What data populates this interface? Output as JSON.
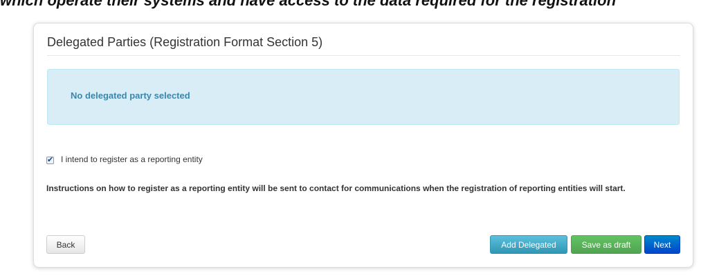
{
  "clipped_header": "which operate their systems and have access to the data required for the registration",
  "panel": {
    "title": "Delegated Parties (Registration Format Section 5)",
    "info_message": "No delegated party selected",
    "checkbox": {
      "checked": true,
      "label": "I intend to register as a reporting entity"
    },
    "instructions": "Instructions on how to register as a reporting entity will be sent to contact for communications when the registration of reporting entities will start."
  },
  "buttons": {
    "back": "Back",
    "add_delegated": "Add Delegated",
    "save_draft": "Save as draft",
    "next": "Next"
  },
  "colors": {
    "info_bg": "#d9edf7",
    "info_text": "#3a87ad",
    "add_button": "#2f96b4",
    "draft_button": "#51a351",
    "next_button": "#0044cc"
  }
}
